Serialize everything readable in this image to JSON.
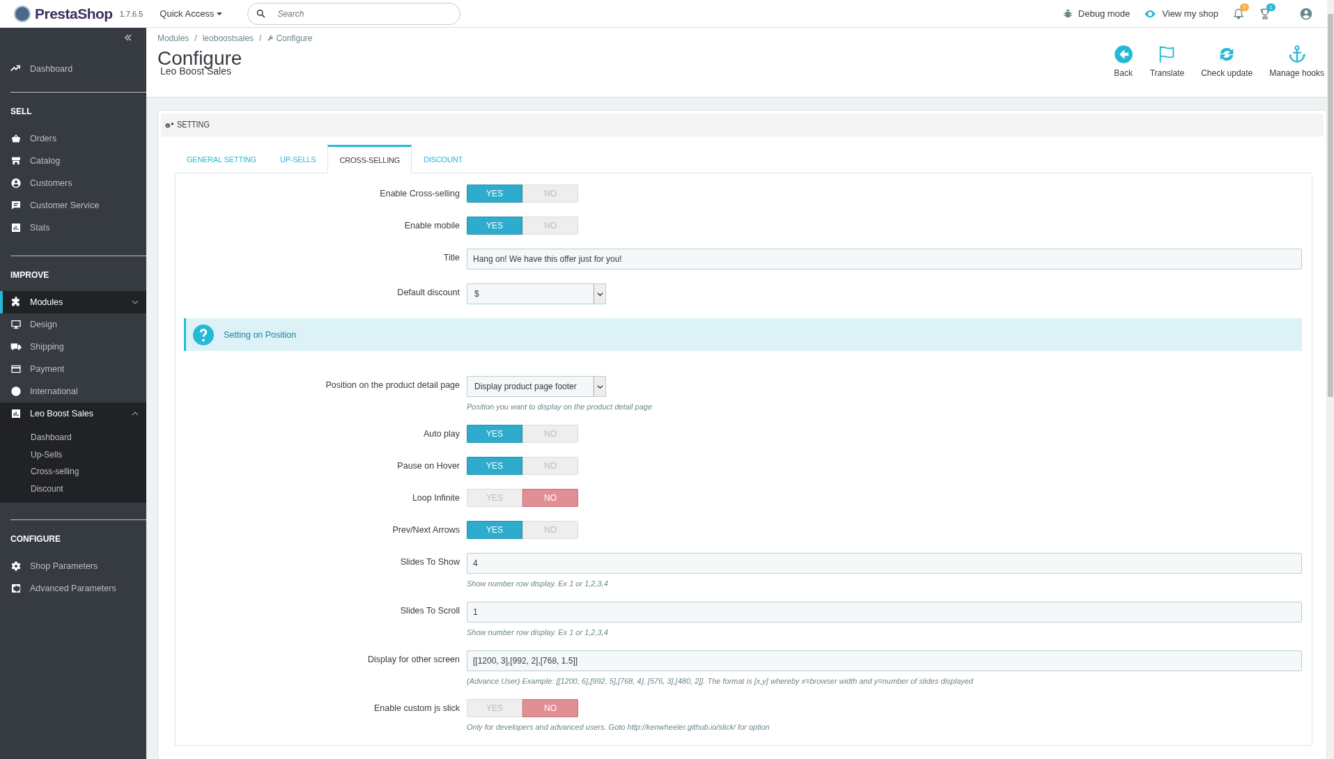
{
  "topbar": {
    "logo": "PrestaShop",
    "version": "1.7.6.5",
    "quick_access": "Quick Access",
    "search": {
      "placeholder": "Search"
    },
    "debug_mode": "Debug mode",
    "view_shop": "View my shop",
    "notifications_badge": "7",
    "trophy_badge": "1"
  },
  "sidebar": {
    "top_item": {
      "label": "Dashboard",
      "selected": false
    },
    "sections": [
      {
        "title": "SELL",
        "items": [
          {
            "label": "Orders",
            "selected": false
          },
          {
            "label": "Catalog",
            "selected": false
          },
          {
            "label": "Customers",
            "selected": false
          },
          {
            "label": "Customer Service",
            "selected": false
          },
          {
            "label": "Stats",
            "selected": false
          }
        ]
      },
      {
        "title": "IMPROVE",
        "items": [
          {
            "label": "Modules",
            "selected": true,
            "expanded": false
          },
          {
            "label": "Design",
            "selected": false
          },
          {
            "label": "Shipping",
            "selected": false
          },
          {
            "label": "Payment",
            "selected": false
          },
          {
            "label": "International",
            "selected": false
          },
          {
            "label": "Leo Boost Sales",
            "selected": false,
            "expanded": true,
            "children": [
              {
                "label": "Dashboard"
              },
              {
                "label": "Up-Sells"
              },
              {
                "label": "Cross-selling"
              },
              {
                "label": "Discount"
              }
            ]
          }
        ]
      },
      {
        "title": "CONFIGURE",
        "items": [
          {
            "label": "Shop Parameters",
            "selected": false
          },
          {
            "label": "Advanced Parameters",
            "selected": false
          }
        ]
      }
    ]
  },
  "breadcrumb": {
    "items": [
      "Modules",
      "leoboostsales",
      "Configure"
    ],
    "separators": [
      "/",
      "/"
    ]
  },
  "header": {
    "title": "Configure",
    "subtitle": "Leo Boost Sales",
    "toolbar": [
      "Back",
      "Translate",
      "Check update",
      "Manage hooks"
    ]
  },
  "panel": {
    "heading": "SETTING",
    "tabs": [
      {
        "label": "GENERAL SETTING",
        "selected": false
      },
      {
        "label": "UP-SELLS",
        "selected": false
      },
      {
        "label": "CROSS-SELLING",
        "selected": true
      },
      {
        "label": "DISCOUNT",
        "selected": false
      }
    ],
    "rows": [
      {
        "kind": "switch",
        "label": "Enable Cross-selling",
        "on": true,
        "yes": "YES",
        "no": "NO"
      },
      {
        "kind": "switch",
        "label": "Enable mobile",
        "on": true,
        "yes": "YES",
        "no": "NO"
      },
      {
        "kind": "text",
        "label": "Title",
        "value": "Hang on! We have this offer just for you!"
      },
      {
        "kind": "select",
        "label": "Default discount",
        "value": "$"
      },
      {
        "kind": "alert",
        "text": "Setting on Position"
      },
      {
        "kind": "select",
        "label": "Position on the product detail page",
        "value": "Display product page footer",
        "help": "Position you want to display on the product detail page"
      },
      {
        "kind": "switch",
        "label": "Auto play",
        "on": true,
        "yes": "YES",
        "no": "NO"
      },
      {
        "kind": "switch",
        "label": "Pause on Hover",
        "on": true,
        "yes": "YES",
        "no": "NO"
      },
      {
        "kind": "switch",
        "label": "Loop Infinite",
        "on": false,
        "yes": "YES",
        "no": "NO"
      },
      {
        "kind": "switch",
        "label": "Prev/Next Arrows",
        "on": true,
        "yes": "YES",
        "no": "NO"
      },
      {
        "kind": "text",
        "label": "Slides To Show",
        "value": "4",
        "help": "Show number row display. Ex 1 or 1,2,3,4"
      },
      {
        "kind": "text",
        "label": "Slides To Scroll",
        "value": "1",
        "help": "Show number row display. Ex 1 or 1,2,3,4"
      },
      {
        "kind": "text",
        "label": "Display for other screen",
        "value": "[[1200, 3],[992, 2],[768, 1.5]]",
        "help": "(Advance User) Example: [[1200, 6],[992, 5],[768, 4], [576, 3],[480, 2]]. The format is [x,y] whereby x=browser width and y=number of slides displayed"
      },
      {
        "kind": "switch",
        "label": "Enable custom js slick",
        "on": false,
        "yes": "YES",
        "no": "NO",
        "help": "Only for developers and advanced users. Goto http://kenwheeler.github.io/slick/ for option"
      }
    ]
  }
}
